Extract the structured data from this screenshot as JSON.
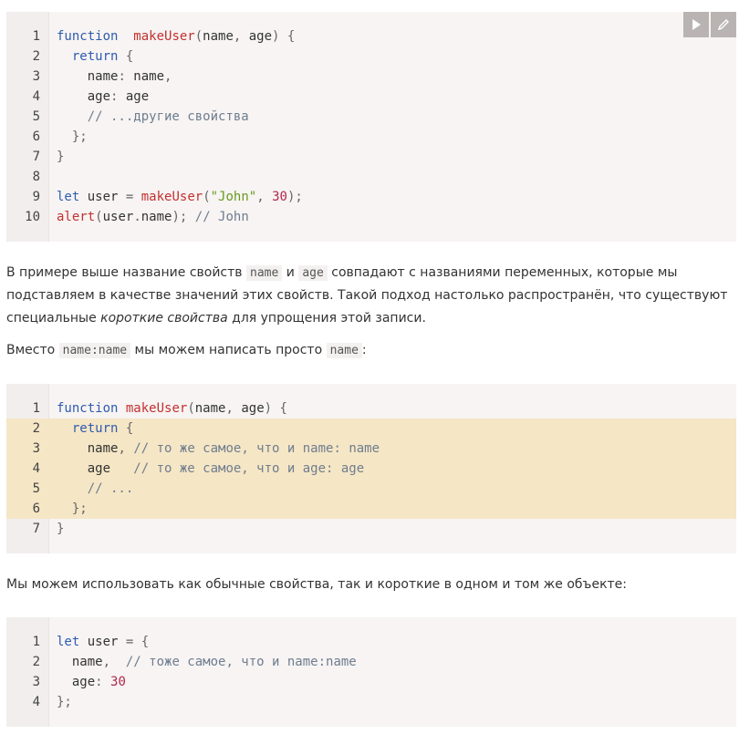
{
  "toolbar": {
    "run_icon": "play-icon",
    "edit_icon": "pencil-icon"
  },
  "code_block_1": {
    "lines": [
      {
        "n": "1",
        "t": [
          [
            "kw",
            "function"
          ],
          [
            "",
            "  "
          ],
          [
            "fn",
            "makeUser"
          ],
          [
            "pn",
            "("
          ],
          [
            "",
            "name"
          ],
          [
            "pn",
            ","
          ],
          [
            "",
            " age"
          ],
          [
            "pn",
            ")"
          ],
          [
            "",
            " "
          ],
          [
            "pn",
            "{"
          ]
        ]
      },
      {
        "n": "2",
        "t": [
          [
            "",
            "  "
          ],
          [
            "kw",
            "return"
          ],
          [
            "",
            " "
          ],
          [
            "pn",
            "{"
          ]
        ]
      },
      {
        "n": "3",
        "t": [
          [
            "",
            "    name"
          ],
          [
            "pn",
            ":"
          ],
          [
            "",
            " name"
          ],
          [
            "pn",
            ","
          ]
        ]
      },
      {
        "n": "4",
        "t": [
          [
            "",
            "    age"
          ],
          [
            "pn",
            ":"
          ],
          [
            "",
            " age"
          ]
        ]
      },
      {
        "n": "5",
        "t": [
          [
            "",
            "    "
          ],
          [
            "cm",
            "// ...другие свойства"
          ]
        ]
      },
      {
        "n": "6",
        "t": [
          [
            "",
            "  "
          ],
          [
            "pn",
            "};"
          ]
        ]
      },
      {
        "n": "7",
        "t": [
          [
            "pn",
            "}"
          ]
        ]
      },
      {
        "n": "8",
        "t": []
      },
      {
        "n": "9",
        "t": [
          [
            "kw",
            "let"
          ],
          [
            "",
            " user "
          ],
          [
            "pn",
            "="
          ],
          [
            "",
            " "
          ],
          [
            "fn",
            "makeUser"
          ],
          [
            "pn",
            "("
          ],
          [
            "str",
            "\"John\""
          ],
          [
            "pn",
            ","
          ],
          [
            "",
            " "
          ],
          [
            "num",
            "30"
          ],
          [
            "pn",
            ");"
          ]
        ]
      },
      {
        "n": "10",
        "t": [
          [
            "fn",
            "alert"
          ],
          [
            "pn",
            "("
          ],
          [
            "",
            "user"
          ],
          [
            "pn",
            "."
          ],
          [
            "",
            "name"
          ],
          [
            "pn",
            ");"
          ],
          [
            "",
            " "
          ],
          [
            "cm",
            "// John"
          ]
        ]
      }
    ]
  },
  "para_1": {
    "p1": "В примере выше название свойств ",
    "c1": "name",
    "p2": " и ",
    "c2": "age",
    "p3": " совпадают с названиями переменных, которые мы подставляем в качестве значений этих свойств. Такой подход настолько распространён, что существуют специальные ",
    "em": "короткие свойства",
    "p4": " для упрощения этой записи."
  },
  "para_2": {
    "p1": "Вместо ",
    "c1": "name:name",
    "p2": " мы можем написать просто ",
    "c2": "name",
    "p3": ":"
  },
  "code_block_2": {
    "lines": [
      {
        "n": "1",
        "hl": false,
        "t": [
          [
            "kw",
            "function"
          ],
          [
            "",
            " "
          ],
          [
            "fn",
            "makeUser"
          ],
          [
            "pn",
            "("
          ],
          [
            "",
            "name"
          ],
          [
            "pn",
            ","
          ],
          [
            "",
            " age"
          ],
          [
            "pn",
            ")"
          ],
          [
            "",
            " "
          ],
          [
            "pn",
            "{"
          ]
        ]
      },
      {
        "n": "2",
        "hl": true,
        "t": [
          [
            "",
            "  "
          ],
          [
            "kw",
            "return"
          ],
          [
            "",
            " "
          ],
          [
            "pn",
            "{"
          ]
        ]
      },
      {
        "n": "3",
        "hl": true,
        "t": [
          [
            "",
            "    name"
          ],
          [
            "pn",
            ","
          ],
          [
            "",
            " "
          ],
          [
            "cm",
            "// то же самое, что и name: name"
          ]
        ]
      },
      {
        "n": "4",
        "hl": true,
        "t": [
          [
            "",
            "    age   "
          ],
          [
            "cm",
            "// то же самое, что и age: age"
          ]
        ]
      },
      {
        "n": "5",
        "hl": true,
        "t": [
          [
            "",
            "    "
          ],
          [
            "cm",
            "// ..."
          ]
        ]
      },
      {
        "n": "6",
        "hl": true,
        "t": [
          [
            "",
            "  "
          ],
          [
            "pn",
            "};"
          ]
        ]
      },
      {
        "n": "7",
        "hl": false,
        "t": [
          [
            "pn",
            "}"
          ]
        ]
      }
    ]
  },
  "para_3": {
    "text": "Мы можем использовать как обычные свойства, так и короткие в одном и том же объекте:"
  },
  "code_block_3": {
    "lines": [
      {
        "n": "1",
        "t": [
          [
            "kw",
            "let"
          ],
          [
            "",
            " user "
          ],
          [
            "pn",
            "="
          ],
          [
            "",
            " "
          ],
          [
            "pn",
            "{"
          ]
        ]
      },
      {
        "n": "2",
        "t": [
          [
            "",
            "  name"
          ],
          [
            "pn",
            ","
          ],
          [
            "",
            "  "
          ],
          [
            "cm",
            "// тоже самое, что и name:name"
          ]
        ]
      },
      {
        "n": "3",
        "t": [
          [
            "",
            "  age"
          ],
          [
            "pn",
            ":"
          ],
          [
            "",
            " "
          ],
          [
            "num",
            "30"
          ]
        ]
      },
      {
        "n": "4",
        "t": [
          [
            "pn",
            "};"
          ]
        ]
      }
    ]
  },
  "colors": {
    "keyword": "#2f5bb0",
    "function": "#c2312f",
    "string": "#6a9a1f",
    "number": "#b2264d",
    "comment": "#6f7d8f",
    "highlight": "#f5e6c5",
    "code_bg": "#f7f4f3"
  }
}
